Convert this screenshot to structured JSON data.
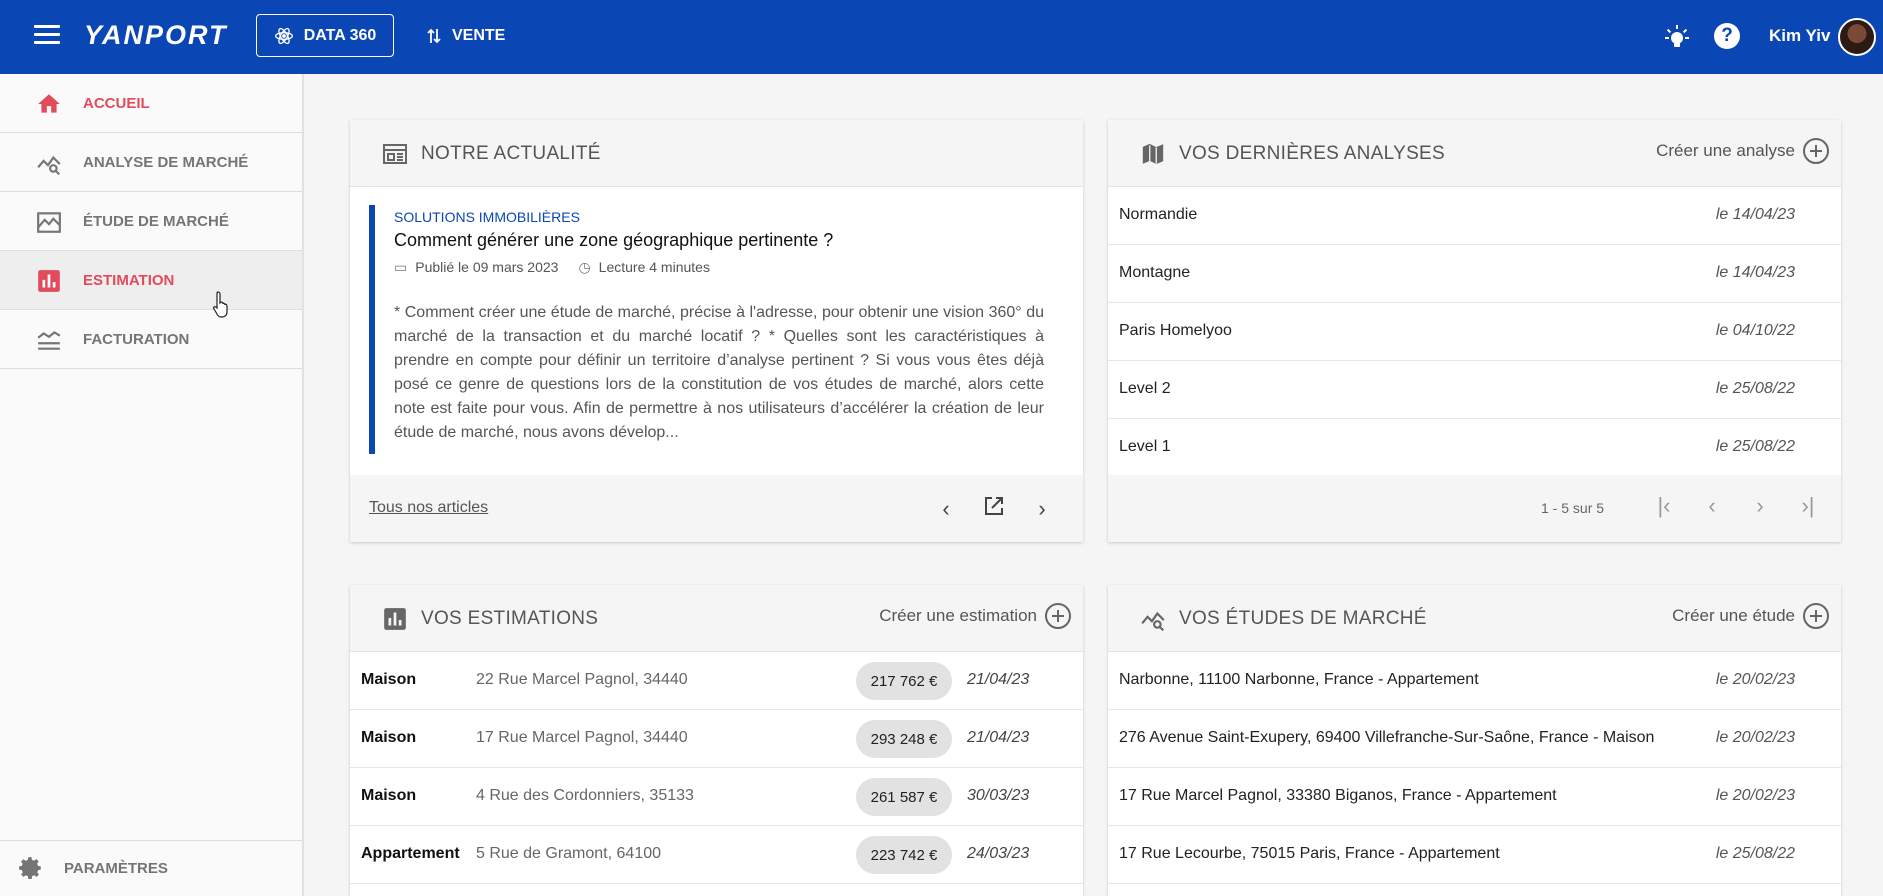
{
  "topbar": {
    "logo": "YANPORT",
    "data360_label": "DATA 360",
    "vente_label": "VENTE",
    "username": "Kim Yiv"
  },
  "sidebar": {
    "items": [
      {
        "label": "ACCUEIL"
      },
      {
        "label": "ANALYSE DE MARCHÉ"
      },
      {
        "label": "ÉTUDE DE MARCHÉ"
      },
      {
        "label": "ESTIMATION"
      },
      {
        "label": "FACTURATION"
      }
    ],
    "settings_label": "PARAMÈTRES"
  },
  "news": {
    "title": "NOTRE ACTUALITÉ",
    "category": "SOLUTIONS IMMOBILIÈRES",
    "article_title": "Comment générer une zone géographique pertinente ?",
    "published": "Publié le 09 mars 2023",
    "reading": "Lecture 4 minutes",
    "excerpt": "* Comment créer une étude de marché, précise à l'adresse, pour obtenir une vision 360° du marché de la transaction et du marché locatif ? * Quelles sont les caractéristiques à prendre en compte pour définir un territoire d’analyse pertinent ? Si vous vous êtes déjà posé ce genre de questions lors de la constitution de vos études de marché, alors cette note est faite pour vous. Afin de  permettre à nos utilisateurs d’accélérer la création de leur étude de marché, nous avons dévelop...",
    "all_articles": "Tous nos articles"
  },
  "analyses": {
    "title": "VOS DERNIÈRES ANALYSES",
    "action": "Créer une analyse",
    "rows": [
      {
        "name": "Normandie",
        "date": "le 14/04/23"
      },
      {
        "name": "Montagne",
        "date": "le 14/04/23"
      },
      {
        "name": "Paris Homelyoo",
        "date": "le 04/10/22"
      },
      {
        "name": "Level 2",
        "date": "le 25/08/22"
      },
      {
        "name": "Level 1",
        "date": "le 25/08/22"
      }
    ],
    "pagination": "1 - 5 sur 5"
  },
  "estimations": {
    "title": "VOS ESTIMATIONS",
    "action": "Créer une estimation",
    "rows": [
      {
        "type": "Maison",
        "address": "22 Rue Marcel Pagnol, 34440",
        "price": "217 762 €",
        "date": "21/04/23"
      },
      {
        "type": "Maison",
        "address": "17 Rue Marcel Pagnol, 34440",
        "price": "293 248 €",
        "date": "21/04/23"
      },
      {
        "type": "Maison",
        "address": "4 Rue des Cordonniers, 35133",
        "price": "261 587 €",
        "date": "30/03/23"
      },
      {
        "type": "Appartement",
        "address": "5 Rue de Gramont, 64100",
        "price": "223 742 €",
        "date": "24/03/23"
      }
    ]
  },
  "etudes": {
    "title": "VOS ÉTUDES DE MARCHÉ",
    "action": "Créer une étude",
    "rows": [
      {
        "name": "Narbonne, 11100 Narbonne, France - Appartement",
        "date": "le 20/02/23"
      },
      {
        "name": "276 Avenue Saint-Exupery, 69400 Villefranche-Sur-Saône, France - Maison",
        "date": "le 20/02/23"
      },
      {
        "name": "17 Rue Marcel Pagnol, 33380 Biganos, France - Appartement",
        "date": "le 20/02/23"
      },
      {
        "name": "17 Rue Lecourbe, 75015 Paris, France - Appartement",
        "date": "le 25/08/22"
      }
    ]
  },
  "colors": {
    "primary": "#0b47b4",
    "accent_red": "#e24b5b"
  }
}
